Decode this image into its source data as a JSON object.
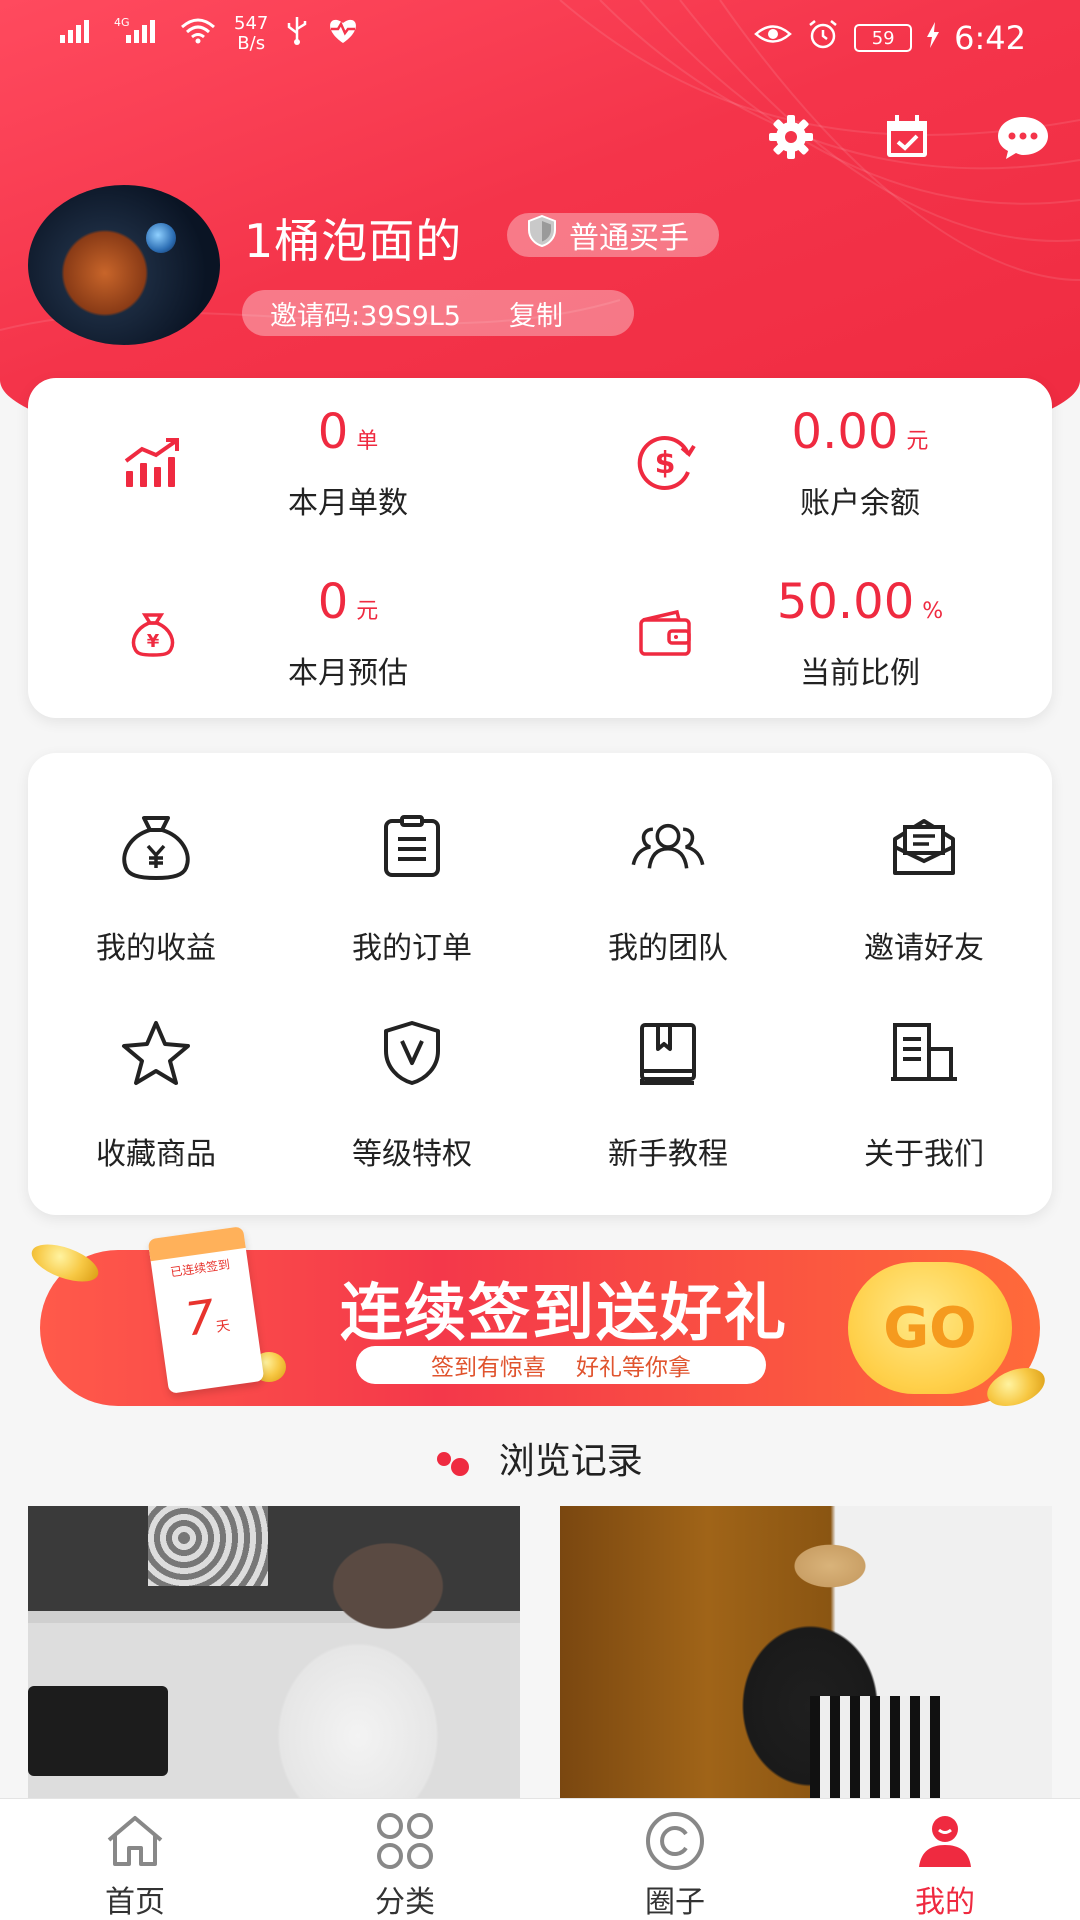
{
  "status_bar": {
    "net_speed_value": "547",
    "net_speed_unit": "B/s",
    "battery": "59",
    "time": "6:42"
  },
  "profile": {
    "username": "1桶泡面的",
    "level": "普通买手",
    "invite_code": "邀请码:39S9L5",
    "copy_label": "复制"
  },
  "stats": [
    {
      "value": "0",
      "unit": "单",
      "label": "本月单数",
      "icon": "trend-chart-icon"
    },
    {
      "value": "0.00",
      "unit": "元",
      "label": "账户余额",
      "icon": "dollar-coin-icon"
    },
    {
      "value": "0",
      "unit": "元",
      "label": "本月预估",
      "icon": "money-bag-icon"
    },
    {
      "value": "50.00",
      "unit": "%",
      "label": "当前比例",
      "icon": "wallet-icon"
    }
  ],
  "menu": [
    {
      "label": "我的收益",
      "icon": "money-bag-icon"
    },
    {
      "label": "我的订单",
      "icon": "clipboard-icon"
    },
    {
      "label": "我的团队",
      "icon": "team-icon"
    },
    {
      "label": "邀请好友",
      "icon": "envelope-icon"
    },
    {
      "label": "收藏商品",
      "icon": "star-icon"
    },
    {
      "label": "等级特权",
      "icon": "shield-v-icon"
    },
    {
      "label": "新手教程",
      "icon": "book-icon"
    },
    {
      "label": "关于我们",
      "icon": "building-icon"
    }
  ],
  "banner": {
    "calendar_caption": "已连续签到",
    "calendar_days": "7",
    "calendar_unit": "天",
    "title": "连续签到送好礼",
    "subtitle_left": "签到有惊喜",
    "subtitle_right": "好礼等你拿",
    "go_label": "GO"
  },
  "history": {
    "title": "浏览记录"
  },
  "bottom_nav": [
    {
      "label": "首页",
      "icon": "home-icon",
      "active": false
    },
    {
      "label": "分类",
      "icon": "category-icon",
      "active": false
    },
    {
      "label": "圈子",
      "icon": "circle-icon",
      "active": false
    },
    {
      "label": "我的",
      "icon": "user-icon",
      "active": true
    }
  ],
  "colors": {
    "brand_red": "#ef2a40",
    "header_gradient_start": "#ff4a5e",
    "go_yellow": "#ffd04a"
  }
}
